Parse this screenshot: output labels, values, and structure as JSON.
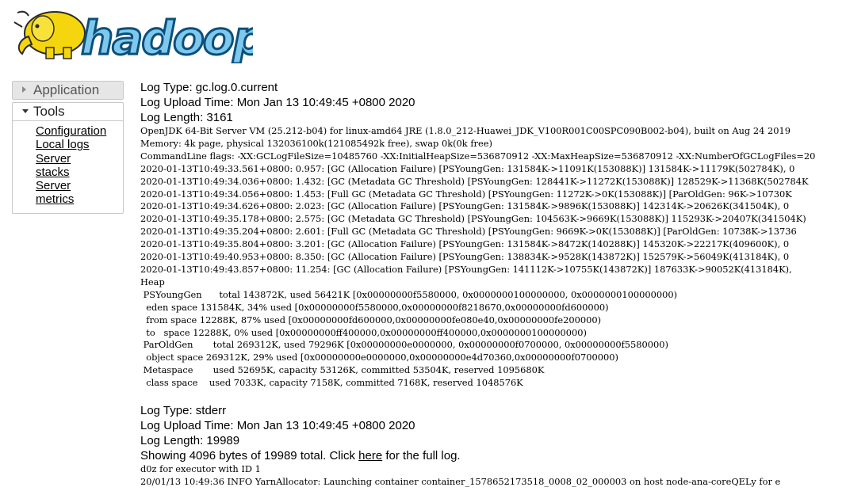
{
  "logo": {
    "text": "hadoop"
  },
  "sidebar": {
    "application_label": "Application",
    "tools_label": "Tools",
    "tools_items": [
      {
        "label": "Configuration"
      },
      {
        "label": "Local logs"
      },
      {
        "label": "Server stacks"
      },
      {
        "label": "Server metrics"
      }
    ]
  },
  "logs": [
    {
      "type": "Log Type: gc.log.0.current",
      "upload_time": "Log Upload Time: Mon Jan 13 10:49:45 +0800 2020",
      "length": "Log Length: 3161",
      "lines": [
        "OpenJDK 64-Bit Server VM (25.212-b04) for linux-amd64 JRE (1.8.0_212-Huawei_JDK_V100R001C00SPC090B002-b04), built on Aug 24 2019",
        "Memory: 4k page, physical 132036100k(121085492k free), swap 0k(0k free)",
        "CommandLine flags: -XX:GCLogFileSize=10485760 -XX:InitialHeapSize=536870912 -XX:MaxHeapSize=536870912 -XX:NumberOfGCLogFiles=20",
        "2020-01-13T10:49:33.561+0800: 0.957: [GC (Allocation Failure) [PSYoungGen: 131584K->11091K(153088K)] 131584K->11179K(502784K), 0",
        "2020-01-13T10:49:34.036+0800: 1.432: [GC (Metadata GC Threshold) [PSYoungGen: 128441K->11272K(153088K)] 128529K->11368K(502784K",
        "2020-01-13T10:49:34.056+0800: 1.453: [Full GC (Metadata GC Threshold) [PSYoungGen: 11272K->0K(153088K)] [ParOldGen: 96K->10730K",
        "2020-01-13T10:49:34.626+0800: 2.023: [GC (Allocation Failure) [PSYoungGen: 131584K->9896K(153088K)] 142314K->20626K(341504K), 0",
        "2020-01-13T10:49:35.178+0800: 2.575: [GC (Metadata GC Threshold) [PSYoungGen: 104563K->9669K(153088K)] 115293K->20407K(341504K)",
        "2020-01-13T10:49:35.204+0800: 2.601: [Full GC (Metadata GC Threshold) [PSYoungGen: 9669K->0K(153088K)] [ParOldGen: 10738K->13736",
        "2020-01-13T10:49:35.804+0800: 3.201: [GC (Allocation Failure) [PSYoungGen: 131584K->8472K(140288K)] 145320K->22217K(409600K), 0",
        "2020-01-13T10:49:40.953+0800: 8.350: [GC (Allocation Failure) [PSYoungGen: 138834K->9528K(143872K)] 152579K->56049K(413184K), 0",
        "2020-01-13T10:49:43.857+0800: 11.254: [GC (Allocation Failure) [PSYoungGen: 141112K->10755K(143872K)] 187633K->90052K(413184K),",
        "Heap",
        " PSYoungGen      total 143872K, used 56421K [0x00000000f5580000, 0x0000000100000000, 0x0000000100000000)",
        "  eden space 131584K, 34% used [0x00000000f5580000,0x00000000f8218670,0x00000000fd600000)",
        "  from space 12288K, 87% used [0x00000000fd600000,0x00000000fe080e40,0x00000000fe200000)",
        "  to   space 12288K, 0% used [0x00000000ff400000,0x00000000ff400000,0x0000000100000000)",
        " ParOldGen       total 269312K, used 79296K [0x00000000e0000000, 0x00000000f0700000, 0x00000000f5580000)",
        "  object space 269312K, 29% used [0x00000000e0000000,0x00000000e4d70360,0x00000000f0700000)",
        " Metaspace       used 52695K, capacity 53126K, committed 53504K, reserved 1095680K",
        "  class space    used 7033K, capacity 7158K, committed 7168K, reserved 1048576K"
      ]
    },
    {
      "type": "Log Type: stderr",
      "upload_time": "Log Upload Time: Mon Jan 13 10:49:45 +0800 2020",
      "length": "Log Length: 19989",
      "showing_prefix": "Showing 4096 bytes of 19989 total. Click ",
      "showing_link": "here",
      "showing_suffix": " for the full log.",
      "lines": [
        "d0z for executor with ID 1",
        "20/01/13 10:49:36 INFO YarnAllocator: Launching container container_1578652173518_0008_02_000003 on host node-ana-coreQELy for e"
      ]
    }
  ]
}
